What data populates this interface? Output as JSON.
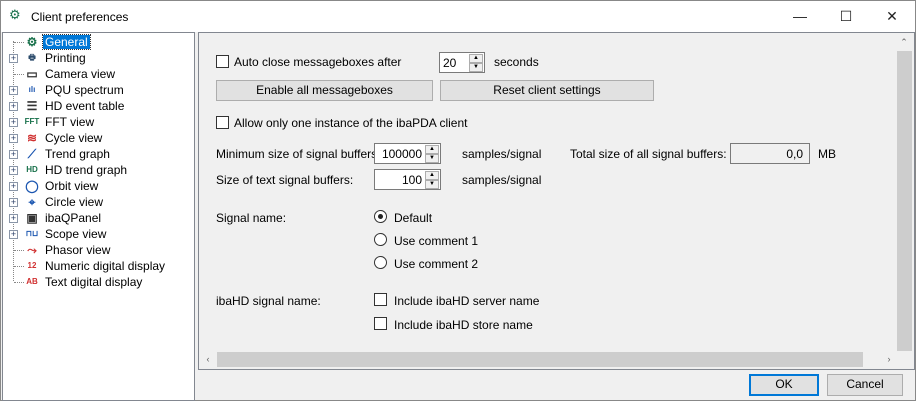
{
  "window": {
    "title": "Client preferences",
    "minimize": "—",
    "maximize": "☐",
    "close": "✕"
  },
  "tree": [
    {
      "label": "General",
      "icon": "gear-icon",
      "glyph": "⚙",
      "color": "#17704a",
      "expand": false
    },
    {
      "label": "Printing",
      "icon": "printer-icon",
      "glyph": "🖶",
      "color": "#2a4a6a",
      "expand": true
    },
    {
      "label": "Camera view",
      "icon": "camera-icon",
      "glyph": "▭",
      "color": "#333",
      "expand": false
    },
    {
      "label": "PQU spectrum",
      "icon": "spectrum-icon",
      "glyph": "ılı",
      "color": "#1a55b0",
      "expand": true
    },
    {
      "label": "HD event table",
      "icon": "event-table-icon",
      "glyph": "☰",
      "color": "#333",
      "expand": true
    },
    {
      "label": "FFT view",
      "icon": "fft-icon",
      "glyph": "FFT",
      "color": "#17704a",
      "expand": true
    },
    {
      "label": "Cycle view",
      "icon": "cycle-icon",
      "glyph": "≋",
      "color": "#d03030",
      "expand": true
    },
    {
      "label": "Trend graph",
      "icon": "trend-icon",
      "glyph": "⟋",
      "color": "#1a55b0",
      "expand": true
    },
    {
      "label": "HD trend graph",
      "icon": "hd-trend-icon",
      "glyph": "HD",
      "color": "#17704a",
      "expand": true
    },
    {
      "label": "Orbit view",
      "icon": "orbit-icon",
      "glyph": "◯",
      "color": "#1a55b0",
      "expand": true
    },
    {
      "label": "Circle view",
      "icon": "circle-icon",
      "glyph": "⌖",
      "color": "#1a55b0",
      "expand": true
    },
    {
      "label": "ibaQPanel",
      "icon": "qpanel-icon",
      "glyph": "▣",
      "color": "#333",
      "expand": true
    },
    {
      "label": "Scope view",
      "icon": "scope-icon",
      "glyph": "⊓⊔",
      "color": "#1a55b0",
      "expand": true
    },
    {
      "label": "Phasor view",
      "icon": "phasor-icon",
      "glyph": "⤳",
      "color": "#d03030",
      "expand": false
    },
    {
      "label": "Numeric digital display",
      "icon": "numeric-display-icon",
      "glyph": "12",
      "color": "#d03030",
      "expand": false
    },
    {
      "label": "Text digital display",
      "icon": "text-display-icon",
      "glyph": "AB",
      "color": "#d03030",
      "expand": false
    }
  ],
  "general": {
    "auto_close_label": "Auto close messageboxes after",
    "auto_close_value": "20",
    "seconds": "seconds",
    "enable_all": "Enable all messageboxes",
    "reset": "Reset client settings",
    "one_instance": "Allow only one instance of the ibaPDA client",
    "min_size_label": "Minimum size of signal buffers:",
    "min_size_value": "100000",
    "unit1": "samples/signal",
    "total_label": "Total size of all signal buffers:",
    "total_value": "0,0",
    "total_unit": "MB",
    "text_size_label": "Size of text signal buffers:",
    "text_size_value": "100",
    "unit2": "samples/signal",
    "signal_name_label": "Signal name:",
    "radio_default": "Default",
    "radio_c1": "Use comment 1",
    "radio_c2": "Use comment 2",
    "hd_label": "ibaHD signal name:",
    "hd_server": "Include ibaHD server name",
    "hd_store": "Include ibaHD store name"
  },
  "footer": {
    "ok": "OK",
    "cancel": "Cancel"
  }
}
